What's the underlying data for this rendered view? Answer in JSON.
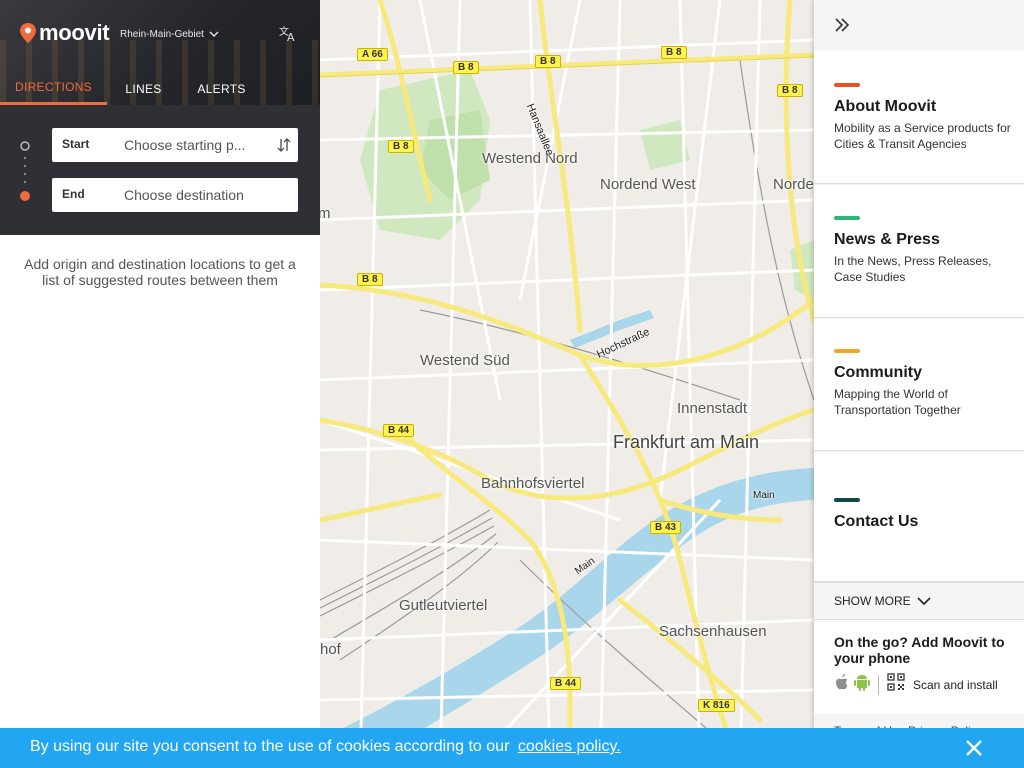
{
  "header": {
    "brand": "moovit",
    "region": "Rhein-Main-Gebiet",
    "tabs": [
      {
        "label": "DIRECTIONS"
      },
      {
        "label": "LINES"
      },
      {
        "label": "ALERTS"
      }
    ]
  },
  "search": {
    "start_label": "Start",
    "start_placeholder": "Choose starting p...",
    "end_label": "End",
    "end_placeholder": "Choose destination",
    "hint": "Add origin and destination locations to get a list of suggested routes between them"
  },
  "map": {
    "labels": {
      "westend_nord": "Westend Nord",
      "nordend_west": "Nordend West",
      "nordend": "Norde",
      "westend_sued": "Westend Süd",
      "innenstadt": "Innenstadt",
      "frankfurt": "Frankfurt am Main",
      "bahnhofsviertel": "Bahnhofsviertel",
      "gutleutviertel": "Gutleutviertel",
      "sachsenhausen": "Sachsenhausen",
      "hansaallee": "Hansaallee",
      "hochstrasse": "Hochstraße",
      "main1": "Main",
      "main2": "Main",
      "edge_m": "m",
      "edge_hof": "hof"
    },
    "shields": {
      "a66": "A 66",
      "b8a": "B 8",
      "b8b": "B 8",
      "b8c": "B 8",
      "b8d": "B 8",
      "b8e": "B 8",
      "b8f": "B 8",
      "b44a": "B 44",
      "b44b": "B 44",
      "b43": "B 43",
      "k816": "K 816"
    }
  },
  "right_panel": {
    "cards": [
      {
        "title": "About Moovit",
        "desc": "Mobility as a Service products for Cities & Transit Agencies",
        "color": "#f04e23"
      },
      {
        "title": "News & Press",
        "desc": "In the News, Press Releases, Case Studies",
        "color": "#2bb673"
      },
      {
        "title": "Community",
        "desc": "Mapping the World of Transportation Together",
        "color": "#f5a623"
      },
      {
        "title": "Contact Us",
        "desc": "",
        "color": "#0e4a4a"
      }
    ],
    "show_more": "SHOW MORE",
    "app_title": "On the go? Add Moovit to your phone",
    "scan_text": "Scan and install",
    "footer_links": "Terms of Use   Privacy Policy"
  },
  "cookie": {
    "text": "By using our site you consent to the use of cookies according to our",
    "link": "cookies policy."
  },
  "colors": {
    "accent": "#f26b3a",
    "cookie_bg": "#22a6f2",
    "panel_dark": "#2f3035"
  }
}
